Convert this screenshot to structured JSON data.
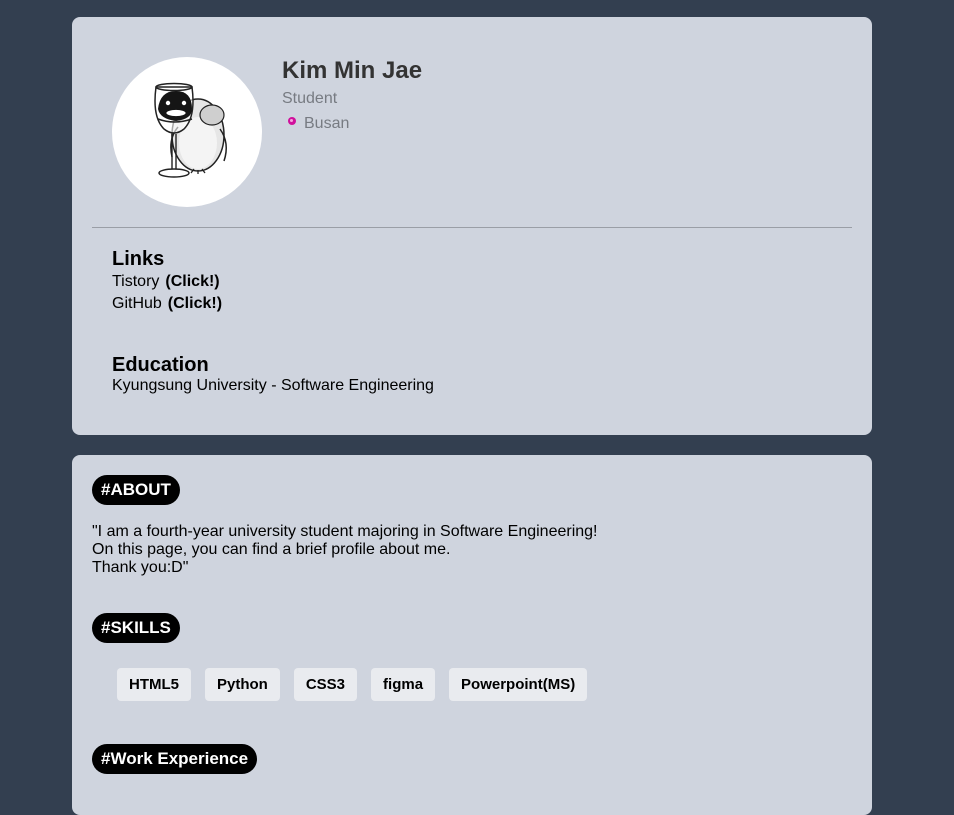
{
  "profile": {
    "name": "Kim Min Jae",
    "role": "Student",
    "location": "Busan",
    "avatar_icon": "penguin-with-wine-glass-icon"
  },
  "links": {
    "title": "Links",
    "items": [
      {
        "label": "Tistory",
        "action": "(Click!)"
      },
      {
        "label": "GitHub",
        "action": "(Click!)"
      }
    ]
  },
  "education": {
    "title": "Education",
    "text": "Kyungsung University - Software Engineering"
  },
  "about": {
    "tag": "#ABOUT",
    "lines": [
      "\"I am a fourth-year university student majoring in Software Engineering!",
      "On this page, you can find a brief profile about me.",
      "Thank you:D\""
    ]
  },
  "skills": {
    "tag": "#SKILLS",
    "items": [
      "HTML5",
      "Python",
      "CSS3",
      "figma",
      "Powerpoint(MS)"
    ]
  },
  "work": {
    "tag": "#Work Experience"
  },
  "colors": {
    "page_bg": "#333f50",
    "card_bg": "#cfd4de",
    "tag_bg": "#000000",
    "location_dot": "#d0109c",
    "muted_text": "#777b82"
  }
}
